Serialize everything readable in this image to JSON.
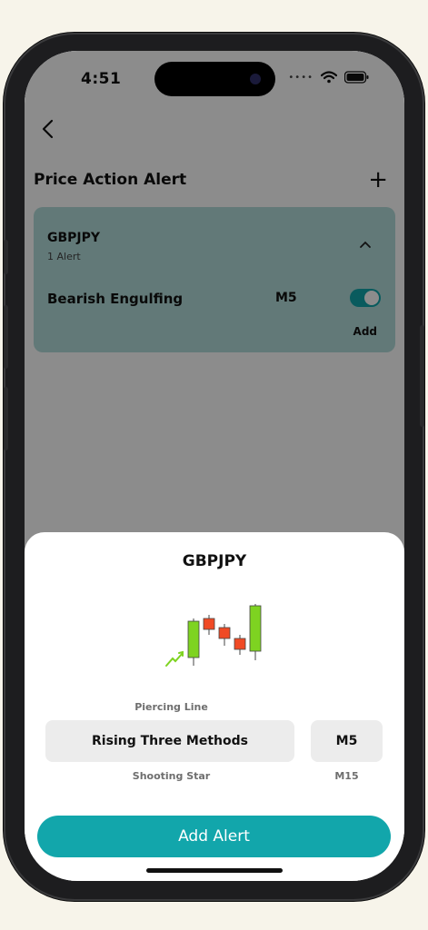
{
  "status_bar": {
    "time": "4:51"
  },
  "header": {
    "title": "Price Action Alert"
  },
  "alert_card": {
    "pair": "GBPJPY",
    "count": "1 Alert",
    "pattern": "Bearish Engulfing",
    "timeframe": "M5",
    "enabled": true,
    "add_label": "Add"
  },
  "sheet": {
    "title": "GBPJPY",
    "pattern_picker": {
      "above": "Piercing Line",
      "selected": "Rising Three Methods",
      "below": "Shooting Star"
    },
    "timeframe_picker": {
      "selected": "M5",
      "below": "M15"
    },
    "cta_label": "Add Alert"
  },
  "colors": {
    "accent": "#12a6ab",
    "card_bg": "#b2dcda",
    "bull_candle": "#7ed321",
    "bear_candle": "#f04a25"
  }
}
